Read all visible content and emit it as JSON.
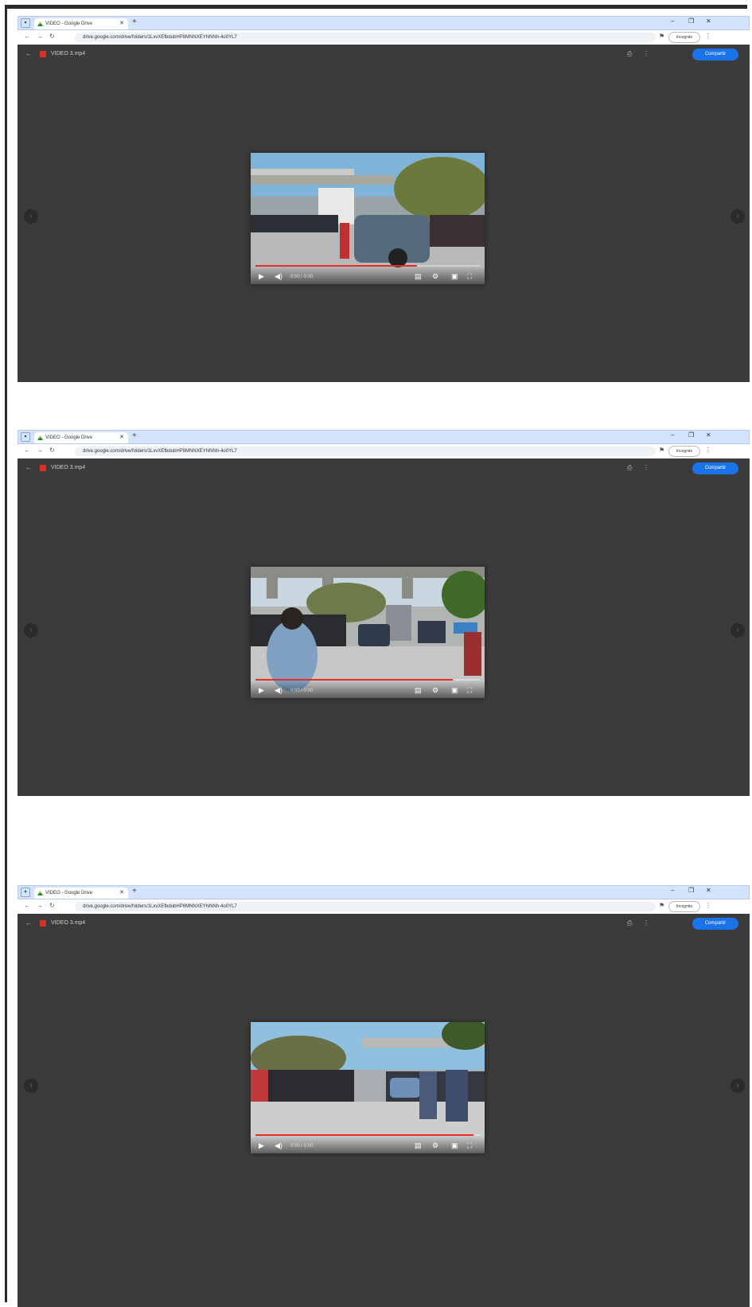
{
  "captures": [
    {
      "tab_title": "VIDEO - Google Drive",
      "url": "drive.google.com/drive/folders/1LxvXEfbdubHP8MNNXEYNNNh-4o0YL7",
      "profile": "Incognito",
      "file_name": "VIDEO 3.mp4",
      "share_label": "Compartir",
      "timecode": "0:00 / 0:00",
      "progress": 0.72,
      "scene": "scene1"
    },
    {
      "tab_title": "VIDEO - Google Drive",
      "url": "drive.google.com/drive/folders/1LxvXEfbdubHP8MNNXEYNNNh-4o0YL7",
      "profile": "Incognito",
      "file_name": "VIDEO 3.mp4",
      "share_label": "Compartir",
      "timecode": "0:00 / 0:00",
      "progress": 0.88,
      "scene": "scene2"
    },
    {
      "tab_title": "VIDEO - Google Drive",
      "url": "drive.google.com/drive/folders/1LxvXEfbdubHP8MNNXEYNNNh-4o0YL7",
      "profile": "Incognito",
      "file_name": "VIDEO 3.mp4",
      "share_label": "Compartir",
      "timecode": "0:00 / 0:00",
      "progress": 0.97,
      "scene": "scene3"
    }
  ],
  "icons": {
    "back": "arrow-left-icon",
    "forward": "arrow-right-icon",
    "reload": "reload-icon",
    "close_tab": "close-icon",
    "new_tab": "plus-icon",
    "play": "play-icon",
    "volume": "volume-icon",
    "captions": "captions-icon",
    "settings": "gear-icon",
    "miniplayer": "miniplayer-icon",
    "fullscreen": "fullscreen-icon",
    "prev": "chevron-left-icon",
    "next": "chevron-right-icon",
    "more": "more-vert-icon"
  },
  "colors": {
    "viewer_bg": "#3b3b3b",
    "share_button": "#1a73e8",
    "progress": "#e52d27",
    "tabstrip": "#d3e3fd"
  }
}
